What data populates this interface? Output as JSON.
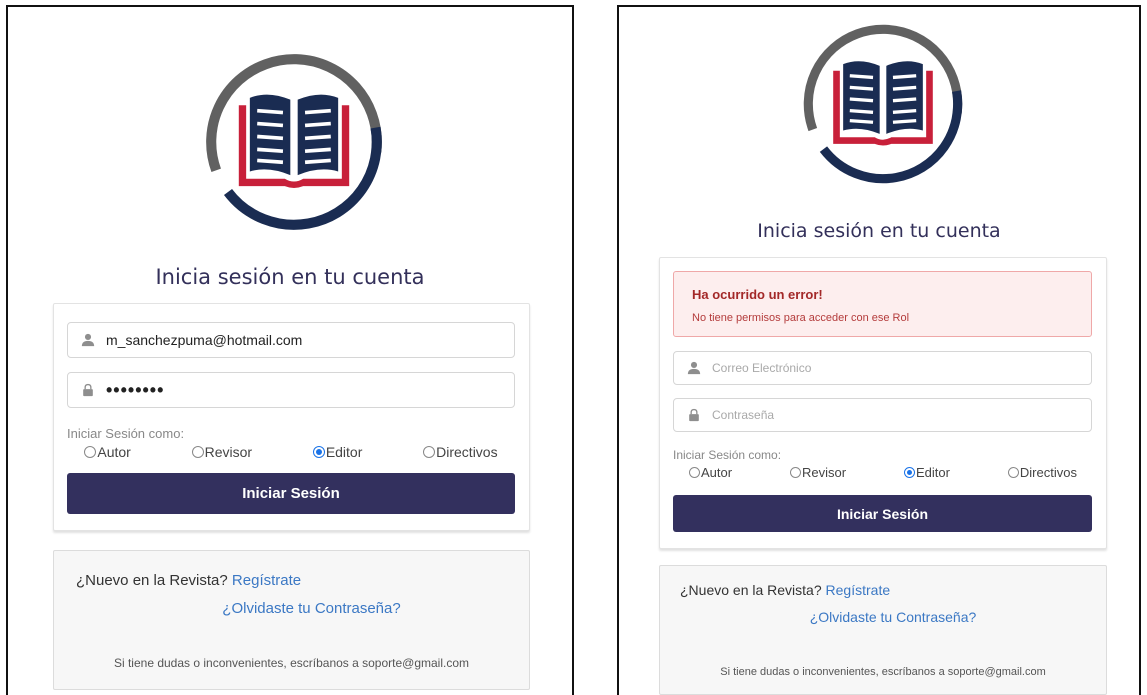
{
  "brand": {
    "navy": "#1a2c52",
    "crimson": "#c8203a",
    "ring_gray": "#616161",
    "button_color": "#33305e",
    "link_color": "#3b78c4"
  },
  "left": {
    "title": "Inicia sesión en tu cuenta",
    "email_value": "m_sanchezpuma@hotmail.com",
    "password_mask": "••••••••",
    "role_label": "Iniciar Sesión como:",
    "roles": [
      "Autor",
      "Revisor",
      "Editor",
      "Directivos"
    ],
    "selected_role": "Editor",
    "submit_label": "Iniciar Sesión",
    "nuevo_text": "¿Nuevo en la Revista?",
    "register_link": "Regístrate",
    "forgot_link": "¿Olvidaste tu Contraseña?",
    "help_text": "Si tiene dudas o inconvenientes, escríbanos a soporte@gmail.com"
  },
  "right": {
    "title": "Inicia sesión en tu cuenta",
    "error_title": "Ha ocurrido un error!",
    "error_message": "No tiene permisos para acceder con ese Rol",
    "email_placeholder": "Correo Electrónico",
    "password_placeholder": "Contraseña",
    "role_label": "Iniciar Sesión como:",
    "roles": [
      "Autor",
      "Revisor",
      "Editor",
      "Directivos"
    ],
    "selected_role": "Editor",
    "submit_label": "Iniciar Sesión",
    "nuevo_text": "¿Nuevo en la Revista?",
    "register_link": "Regístrate",
    "forgot_link": "¿Olvidaste tu Contraseña?",
    "help_text": "Si tiene dudas o inconvenientes, escríbanos a soporte@gmail.com"
  },
  "icons": {
    "logo": "open-book-logo-icon",
    "user": "user-icon",
    "lock": "lock-icon"
  }
}
